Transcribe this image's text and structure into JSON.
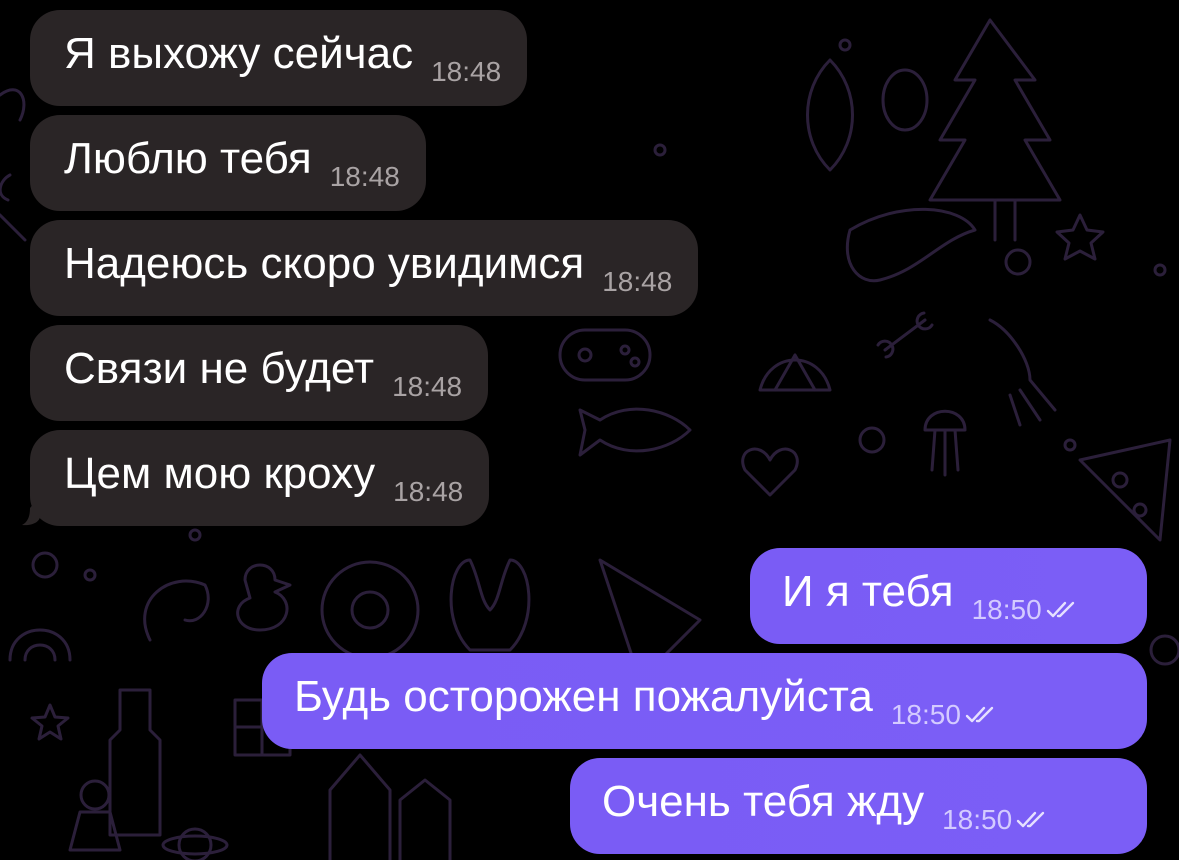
{
  "colors": {
    "background": "#000000",
    "incoming_bubble": "#2a2526",
    "outgoing_bubble": "#7a5cf5",
    "incoming_time": "#a9a3a4",
    "outgoing_time": "#d4cbff"
  },
  "messages": [
    {
      "direction": "incoming",
      "text": "Я выхожу сейчас",
      "time": "18:48"
    },
    {
      "direction": "incoming",
      "text": "Люблю тебя",
      "time": "18:48"
    },
    {
      "direction": "incoming",
      "text": "Надеюсь скоро увидимся",
      "time": "18:48"
    },
    {
      "direction": "incoming",
      "text": "Связи не будет",
      "time": "18:48"
    },
    {
      "direction": "incoming",
      "text": "Цем мою кроху",
      "time": "18:48"
    },
    {
      "direction": "outgoing",
      "text": "И я тебя",
      "time": "18:50",
      "status_icon": "double-check-icon"
    },
    {
      "direction": "outgoing",
      "text": "Будь осторожен пожалуйста",
      "time": "18:50",
      "status_icon": "double-check-icon"
    },
    {
      "direction": "outgoing",
      "text": "Очень тебя жду",
      "time": "18:50",
      "status_icon": "double-check-icon"
    }
  ]
}
